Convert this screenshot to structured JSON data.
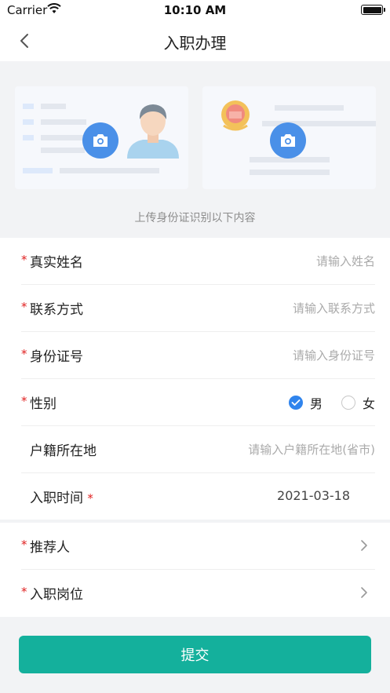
{
  "status_bar": {
    "carrier": "Carrier",
    "time": "10:10 AM"
  },
  "nav": {
    "title": "入职办理",
    "back_icon": "chevron-left-icon"
  },
  "upload": {
    "hint": "上传身份证识别以下内容",
    "camera_icon": "camera-icon"
  },
  "form": {
    "name": {
      "label": "真实姓名",
      "placeholder": "请输入姓名",
      "required": "*"
    },
    "contact": {
      "label": "联系方式",
      "placeholder": "请输入联系方式",
      "required": "*"
    },
    "id_number": {
      "label": "身份证号",
      "placeholder": "请输入身份证号",
      "required": "*"
    },
    "gender": {
      "label": "性别",
      "required": "*",
      "options": [
        "男",
        "女"
      ],
      "selected": "男"
    },
    "hukou": {
      "label": "户籍所在地",
      "placeholder": "请输入户籍所在地(省市)"
    },
    "hire_date": {
      "label": "入职时间",
      "required": "*",
      "value": "2021-03-18"
    },
    "referrer": {
      "label": "推荐人",
      "required": "*"
    },
    "position": {
      "label": "入职岗位",
      "required": "*"
    }
  },
  "submit_label": "提交",
  "colors": {
    "accent": "#14b09c",
    "radio_checked": "#2f84ed",
    "camera": "#4a90e8",
    "required": "#e02020"
  }
}
